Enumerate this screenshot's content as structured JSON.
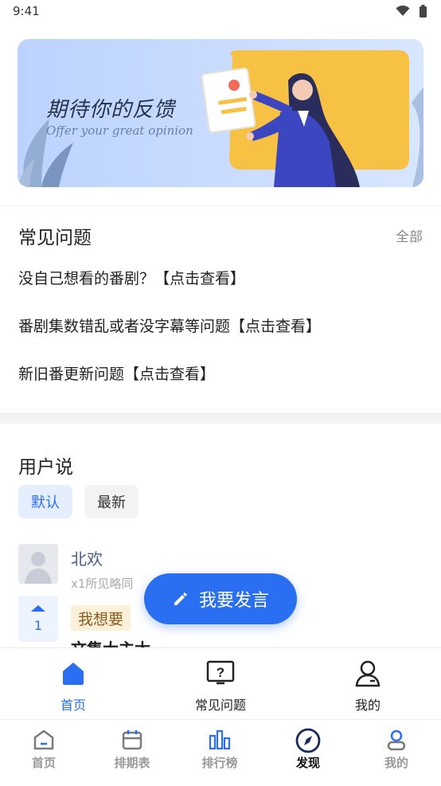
{
  "status": {
    "time": "9:41"
  },
  "banner": {
    "title": "期待你的反馈",
    "subtitle": "Offer your great opinion"
  },
  "faq": {
    "heading": "常见问题",
    "all_label": "全部",
    "items": [
      "没自己想看的番剧？【点击查看】",
      "番剧集数错乱或者没字幕等问题【点击查看】",
      "新旧番更新问题【点击查看】"
    ]
  },
  "users": {
    "heading": "用户说",
    "filters": [
      "默认",
      "最新"
    ],
    "post": {
      "name": "北欢",
      "meta": "x1所见略同",
      "votes": "1",
      "tag": "我想要",
      "partial": "文集大主太"
    }
  },
  "fab": {
    "label": "我要发言",
    "icon": "pencil-icon"
  },
  "tabbar_inner": [
    {
      "label": "首页",
      "icon": "home-icon"
    },
    {
      "label": "常见问题",
      "icon": "question-icon"
    },
    {
      "label": "我的",
      "icon": "user-icon"
    }
  ],
  "tabbar_main": [
    {
      "label": "首页",
      "icon": "home-outline-icon"
    },
    {
      "label": "排期表",
      "icon": "calendar-icon"
    },
    {
      "label": "排行榜",
      "icon": "bar-chart-icon"
    },
    {
      "label": "发现",
      "icon": "compass-icon"
    },
    {
      "label": "我的",
      "icon": "profile-icon"
    }
  ],
  "colors": {
    "accent": "#2a6ff2",
    "banner_bg": "#bcd3ff",
    "tag_bg": "#fdf0d9"
  }
}
